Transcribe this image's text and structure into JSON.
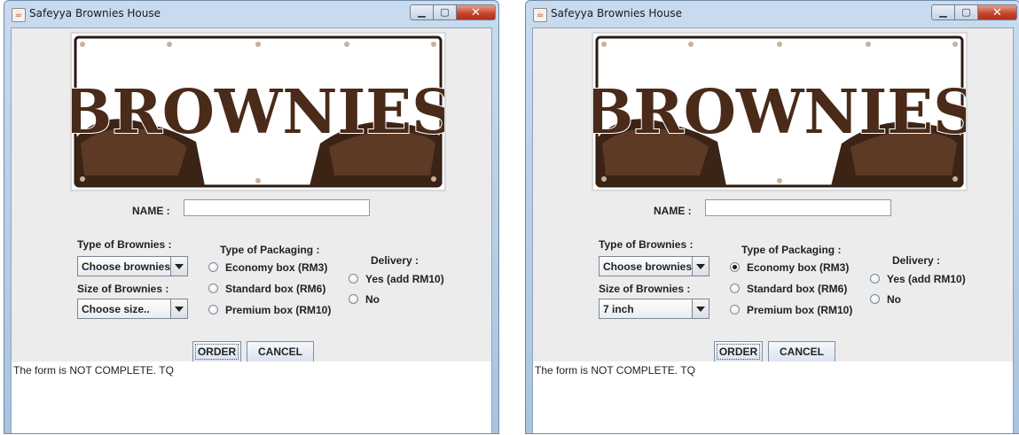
{
  "colors": {
    "title_bar": "#b7cde6",
    "client_bg": "#ececec",
    "close_button": "#c4422a"
  },
  "windows": [
    {
      "title": "Safeyya Brownies House",
      "banner_text": "BROWNIES",
      "name_label": "NAME :",
      "name_value": "",
      "type_label": "Type of Brownies :",
      "type_value": "Choose brownies..",
      "size_label": "Size of Brownies :",
      "size_value": "Choose size..",
      "packaging_label": "Type of Packaging :",
      "packaging": [
        {
          "label": "Economy box (RM3)",
          "selected": false
        },
        {
          "label": "Standard box (RM6)",
          "selected": false
        },
        {
          "label": "Premium box (RM10)",
          "selected": false
        }
      ],
      "delivery_label": "Delivery :",
      "delivery": [
        {
          "label": "Yes (add RM10)",
          "selected": false
        },
        {
          "label": "No",
          "selected": false
        }
      ],
      "order_label": "ORDER",
      "cancel_label": "CANCEL",
      "output_text": "The form is NOT COMPLETE. TQ"
    },
    {
      "title": "Safeyya Brownies House",
      "banner_text": "BROWNIES",
      "name_label": "NAME :",
      "name_value": "",
      "type_label": "Type of Brownies :",
      "type_value": "Choose brownies..",
      "size_label": "Size of Brownies :",
      "size_value": "7 inch",
      "packaging_label": "Type of Packaging :",
      "packaging": [
        {
          "label": "Economy box (RM3)",
          "selected": true
        },
        {
          "label": "Standard box (RM6)",
          "selected": false
        },
        {
          "label": "Premium box (RM10)",
          "selected": false
        }
      ],
      "delivery_label": "Delivery :",
      "delivery": [
        {
          "label": "Yes (add RM10)",
          "selected": false
        },
        {
          "label": "No",
          "selected": false
        }
      ],
      "order_label": "ORDER",
      "cancel_label": "CANCEL",
      "output_text": "The form is NOT COMPLETE. TQ"
    }
  ]
}
